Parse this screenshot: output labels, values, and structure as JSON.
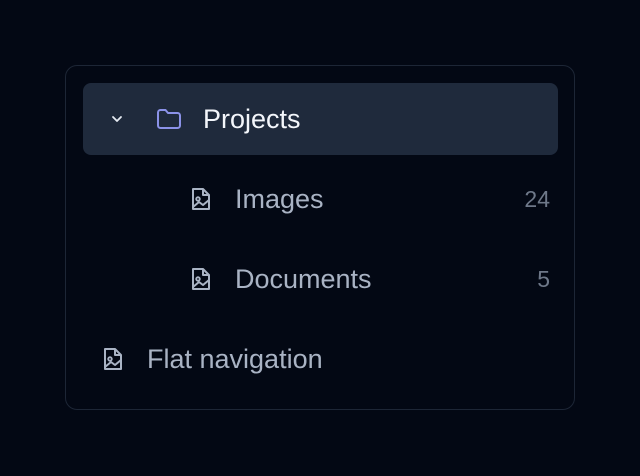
{
  "colors": {
    "background": "#030814",
    "panel_border": "#1d2636",
    "selected_row": "#1f2a3c",
    "folder_accent": "#8b92e8",
    "text_active": "#f3f6fb",
    "text_muted": "#a9b3c4",
    "count": "#6e7889"
  },
  "tree": {
    "projects": {
      "label": "Projects",
      "icon": "folder-icon",
      "expanded": true,
      "selected": true,
      "children": [
        {
          "label": "Images",
          "icon": "file-image-icon",
          "count": "24"
        },
        {
          "label": "Documents",
          "icon": "file-image-icon",
          "count": "5"
        }
      ]
    },
    "flat": {
      "label": "Flat navigation",
      "icon": "file-image-icon"
    }
  }
}
